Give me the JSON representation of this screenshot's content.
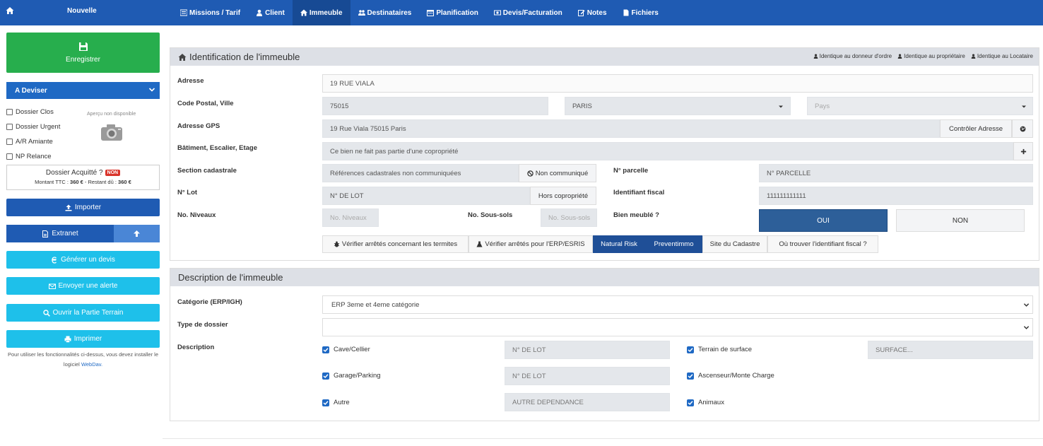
{
  "nav": {
    "home_icon": "home-icon",
    "nouvelle": "Nouvelle",
    "tabs": [
      {
        "label": "Missions / Tarif",
        "icon": "list-icon"
      },
      {
        "label": "Client",
        "icon": "user-icon"
      },
      {
        "label": "Immeuble",
        "icon": "home-icon"
      },
      {
        "label": "Destinataires",
        "icon": "users-icon"
      },
      {
        "label": "Planification",
        "icon": "calendar-icon"
      },
      {
        "label": "Devis/Facturation",
        "icon": "money-icon"
      },
      {
        "label": "Notes",
        "icon": "edit-icon"
      },
      {
        "label": "Fichiers",
        "icon": "file-icon"
      }
    ],
    "active_tab": "Immeuble"
  },
  "sidebar": {
    "save_label": "Enregistrer",
    "status_value": "A Deviser",
    "checks": [
      "Dossier Clos",
      "Dossier Urgent",
      "A/R Amiante",
      "NP Relance"
    ],
    "apercu": "Aperçu non disponible",
    "acquitte_label": "Dossier Acquitté ?",
    "acquitte_badge": "NON",
    "montant_label": "Montant TTC :",
    "montant_value": "360 €",
    "restant_label": "- Restant dû :",
    "restant_value": "360 €",
    "importer": "Importer",
    "extranet": "Extranet",
    "generer_devis": "Générer un devis",
    "envoyer_alerte": "Envoyer une alerte",
    "ouvrir_terrain": "Ouvrir la Partie Terrain",
    "imprimer": "Imprimer",
    "note_text": "Pour utiliser les fonctionnalités ci-dessus, vous devez installer le logiciel",
    "note_link": "WebDav."
  },
  "identification": {
    "title": "Identification de l'immeuble",
    "links": [
      "Identique au donneur d'ordre",
      "Identique au propriétaire",
      "Identique au Locataire"
    ],
    "adresse_label": "Adresse",
    "adresse_value": "19 RUE  VIALA",
    "cp_label": "Code Postal, Ville",
    "cp_value": "75015",
    "ville_value": "PARIS",
    "pays_placeholder": "Pays",
    "gps_label": "Adresse GPS",
    "gps_value": "19 Rue Viala 75015 Paris",
    "gps_button": "Contrôler Adresse",
    "batiment_label": "Bâtiment, Escalier, Etage",
    "batiment_value": "Ce bien ne fait pas partie d'une copropriété",
    "section_label": "Section cadastrale",
    "section_value": "Références cadastrales non communiquées",
    "non_communique": "Non communiqué",
    "parcelle_label": "N° parcelle",
    "parcelle_value": "N° PARCELLE",
    "lot_label": "N° Lot",
    "lot_value": "N° DE LOT",
    "hors_copro": "Hors copropriété",
    "fiscal_label": "Identifiant fiscal",
    "fiscal_value": "111111111111",
    "niveaux_label": "No. Niveaux",
    "niveaux_placeholder": "No. Niveaux",
    "soussols_label": "No. Sous-sols",
    "soussols_placeholder": "No. Sous-sols",
    "meuble_label": "Bien meublé ?",
    "oui": "OUI",
    "non": "NON",
    "btn_termites": "Vérifier arrêtés concernant les termites",
    "btn_erp": "Vérifier arrêtés pour l'ERP/ESRIS",
    "btn_natural": "Natural Risk",
    "btn_preventimmo": "Preventimmo",
    "btn_cadastre": "Site du Cadastre",
    "btn_fiscal": "Où trouver l'identifiant fiscal ?"
  },
  "description": {
    "title": "Description de l'immeuble",
    "categorie_label": "Catégorie (ERP/IGH)",
    "categorie_value": "ERP 3eme et 4eme catégorie",
    "type_label": "Type de dossier",
    "type_value": "",
    "desc_label": "Description",
    "items": [
      {
        "label": "Cave/Cellier",
        "placeholder": "N° DE LOT"
      },
      {
        "label": "Garage/Parking",
        "placeholder": "N° DE LOT"
      },
      {
        "label": "Autre",
        "placeholder": "AUTRE DEPENDANCE"
      }
    ],
    "right_items": [
      {
        "label": "Terrain de surface",
        "placeholder": "SURFACE..."
      },
      {
        "label": "Ascenseur/Monte Charge"
      },
      {
        "label": "Animaux"
      }
    ]
  }
}
